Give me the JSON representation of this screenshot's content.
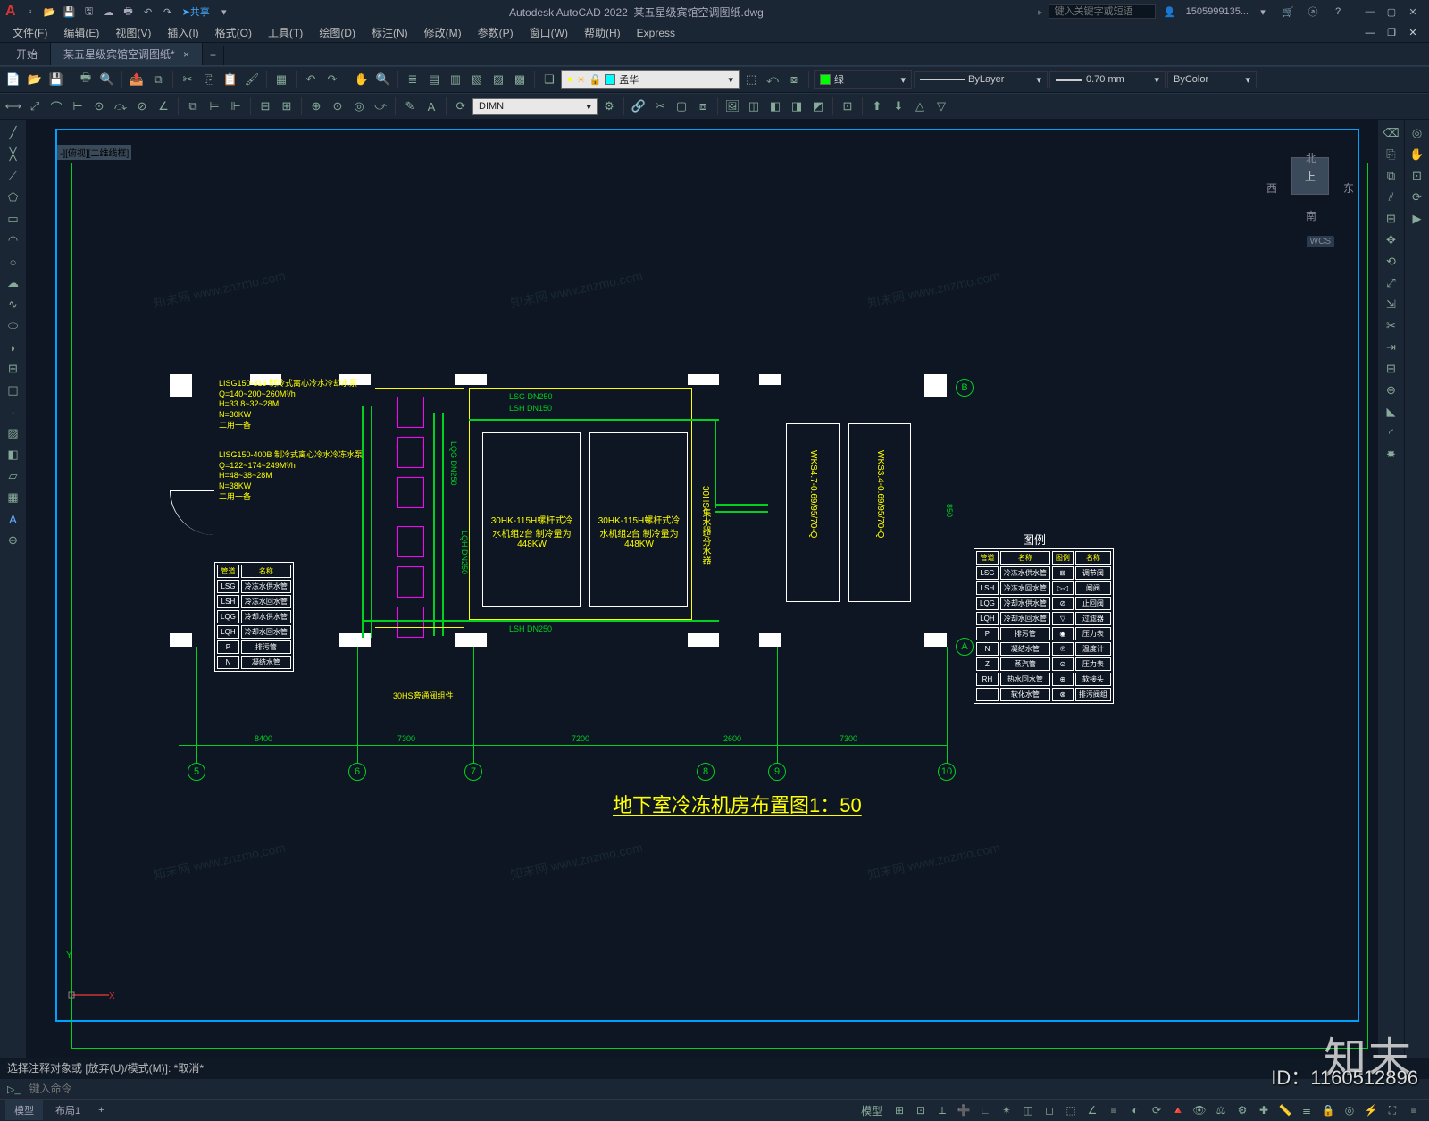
{
  "app": {
    "title": "Autodesk AutoCAD 2022",
    "doc": "某五星级宾馆空调图纸.dwg",
    "share": "共享"
  },
  "search": {
    "placeholder": "键入关键字或短语"
  },
  "user": {
    "name": "1505999135..."
  },
  "menu": {
    "items": [
      "文件(F)",
      "编辑(E)",
      "视图(V)",
      "插入(I)",
      "格式(O)",
      "工具(T)",
      "绘图(D)",
      "标注(N)",
      "修改(M)",
      "参数(P)",
      "窗口(W)",
      "帮助(H)",
      "Express"
    ]
  },
  "tabs": {
    "start": "开始",
    "doc": "某五星级宾馆空调图纸*"
  },
  "layer": {
    "name": "孟华"
  },
  "colorctrl": {
    "name": "绿"
  },
  "linetype": {
    "name": "ByLayer"
  },
  "lineweight": {
    "name": "0.70 mm"
  },
  "plotstyle": {
    "name": "ByColor"
  },
  "dimstyle": {
    "name": "DIMN"
  },
  "viewport_label": "-][俯视][二维线框]",
  "viewcube": {
    "n": "北",
    "s": "南",
    "e": "东",
    "w": "西",
    "top": "上"
  },
  "wcs": "WCS",
  "drawing": {
    "title": "地下室冷冻机房布置图1：50",
    "legend_header": "图例",
    "notes": [
      {
        "l1": "LISG150-315 制冷式离心冷水冷却水泵",
        "l2": "Q=140~200~260M³/h",
        "l3": "H=33.8~32~28M",
        "l4": "N=30KW",
        "l5": "二用一备"
      },
      {
        "l1": "LISG150-400B 制冷式离心冷水冷冻水泵",
        "l2": "Q=122~174~249M³/h",
        "l3": "H=48~38~28M",
        "l4": "N=38KW",
        "l5": "二用一备"
      }
    ],
    "equip": {
      "chiller1": "30HK-115H螺杆式冷水机组2台 制冷量为448KW",
      "chiller2": "30HK-115H螺杆式冷水机组2台 制冷量为448KW",
      "collector": "30HS集水器/分水器",
      "tower1": "WKS4.7-0.69/95/70-Q",
      "tower2": "WKS3.4-0.69/95/70-Q",
      "bypass": "30HS旁通阀组件"
    },
    "pipe_labels": [
      "LSG DN250",
      "LSH DN150",
      "LQG DN250",
      "LQH DN250",
      "LSH DN250"
    ],
    "grids": [
      "5",
      "6",
      "7",
      "8",
      "9",
      "10"
    ],
    "grids_v": [
      "A",
      "B"
    ],
    "dims": [
      "8400",
      "7300",
      "7200",
      "2600",
      "7300",
      "850"
    ],
    "legend_rows": [
      [
        "管道",
        "名称",
        "图例",
        "名称"
      ],
      [
        "LSG",
        "冷冻水供水管",
        "⊠",
        "调节阀"
      ],
      [
        "LSH",
        "冷冻水回水管",
        "▷◁",
        "闸阀"
      ],
      [
        "LQG",
        "冷却水供水管",
        "⊘",
        "止回阀"
      ],
      [
        "LQH",
        "冷却水回水管",
        "▽",
        "过滤器"
      ],
      [
        "P",
        "排污管",
        "◉",
        "压力表"
      ],
      [
        "N",
        "凝结水管",
        "℗",
        "温度计"
      ],
      [
        "Z",
        "蒸汽管",
        "⊙",
        "压力表"
      ],
      [
        "RH",
        "热水回水管",
        "⊕",
        "软接头"
      ],
      [
        "",
        "软化水管",
        "⊗",
        "排污阀组"
      ]
    ],
    "small_legend_rows": [
      [
        "管道",
        "名称"
      ],
      [
        "LSG",
        "冷冻水供水管"
      ],
      [
        "LSH",
        "冷冻水回水管"
      ],
      [
        "LQG",
        "冷却水供水管"
      ],
      [
        "LQH",
        "冷却水回水管"
      ],
      [
        "P",
        "排污管"
      ],
      [
        "N",
        "凝结水管"
      ]
    ]
  },
  "command": {
    "history": "选择注释对象或 [放弃(U)/模式(M)]: *取消*",
    "placeholder": "键入命令"
  },
  "status": {
    "tabs": [
      "模型",
      "布局1"
    ],
    "model_label": "模型"
  },
  "page_id": "ID：1160512896",
  "branding": "知末",
  "watermark": "知末网 www.znzmo.com"
}
